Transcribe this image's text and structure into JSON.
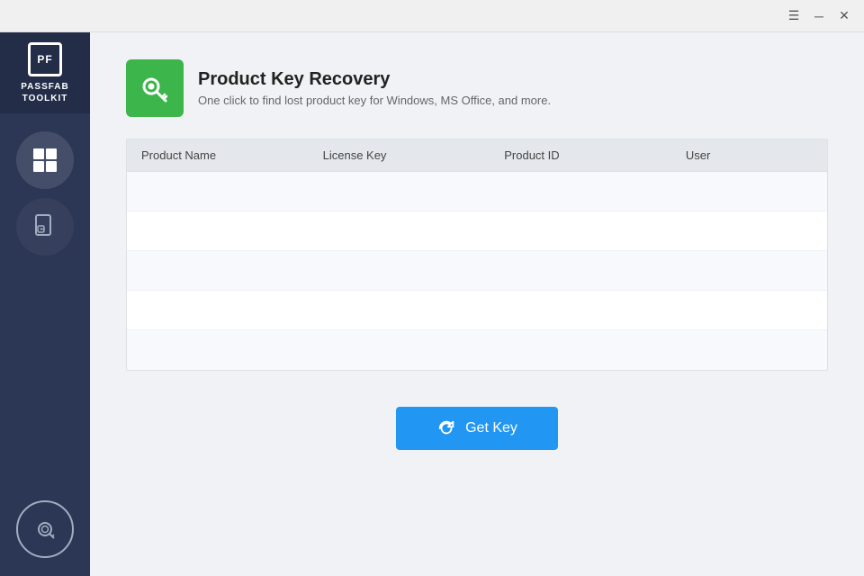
{
  "titlebar": {
    "menu_label": "☰",
    "minimize_label": "─",
    "close_label": "✕"
  },
  "sidebar": {
    "logo_text": "PASSFAB\nTOOLKIT",
    "nav_items": [
      {
        "id": "windows",
        "label": "Windows",
        "icon": "windows-icon",
        "active": true
      },
      {
        "id": "file-key",
        "label": "File Key",
        "icon": "file-key-icon",
        "active": false
      }
    ],
    "bottom_item": {
      "id": "product-key",
      "label": "Product Key",
      "icon": "key-icon"
    }
  },
  "header": {
    "title": "Product Key Recovery",
    "subtitle": "One click to find lost product key for Windows, MS Office, and more.",
    "icon_alt": "product-key-recovery-icon"
  },
  "table": {
    "columns": [
      "Product Name",
      "License Key",
      "Product ID",
      "User"
    ],
    "rows": [
      {
        "product_name": "",
        "license_key": "",
        "product_id": "",
        "user": ""
      },
      {
        "product_name": "",
        "license_key": "",
        "product_id": "",
        "user": ""
      },
      {
        "product_name": "",
        "license_key": "",
        "product_id": "",
        "user": ""
      },
      {
        "product_name": "",
        "license_key": "",
        "product_id": "",
        "user": ""
      },
      {
        "product_name": "",
        "license_key": "",
        "product_id": "",
        "user": ""
      }
    ]
  },
  "button": {
    "label": "Get Key",
    "icon": "refresh-icon"
  }
}
